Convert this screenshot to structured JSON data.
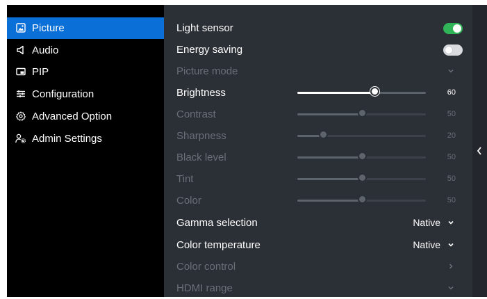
{
  "sidebar": {
    "items": [
      {
        "label": "Picture",
        "icon": "picture-icon",
        "active": true
      },
      {
        "label": "Audio",
        "icon": "speaker-icon",
        "active": false
      },
      {
        "label": "PIP",
        "icon": "pip-icon",
        "active": false
      },
      {
        "label": "Configuration",
        "icon": "sliders-icon",
        "active": false
      },
      {
        "label": "Advanced Option",
        "icon": "gear-icon",
        "active": false
      },
      {
        "label": "Admin Settings",
        "icon": "admin-icon",
        "active": false
      }
    ]
  },
  "main": {
    "light_sensor": {
      "label": "Light sensor",
      "on": true
    },
    "energy_saving": {
      "label": "Energy saving",
      "on": false
    },
    "picture_mode": {
      "label": "Picture mode"
    },
    "sliders": [
      {
        "label": "Brightness",
        "value": "60",
        "level": 60,
        "enabled": true
      },
      {
        "label": "Contrast",
        "value": "50",
        "level": 50,
        "enabled": false
      },
      {
        "label": "Sharpness",
        "value": "20",
        "level": 20,
        "enabled": false
      },
      {
        "label": "Black level",
        "value": "50",
        "level": 50,
        "enabled": false
      },
      {
        "label": "Tint",
        "value": "50",
        "level": 50,
        "enabled": false
      },
      {
        "label": "Color",
        "value": "50",
        "level": 50,
        "enabled": false
      }
    ],
    "gamma_selection": {
      "label": "Gamma selection",
      "value": "Native"
    },
    "color_temperature": {
      "label": "Color temperature",
      "value": "Native"
    },
    "color_control": {
      "label": "Color control"
    },
    "hdmi_range": {
      "label": "HDMI range"
    }
  },
  "colors": {
    "accent": "#0a6fd6",
    "toggle_on": "#2fb457",
    "sidebar_bg": "#000000",
    "panel_bg": "#2b2f36"
  }
}
